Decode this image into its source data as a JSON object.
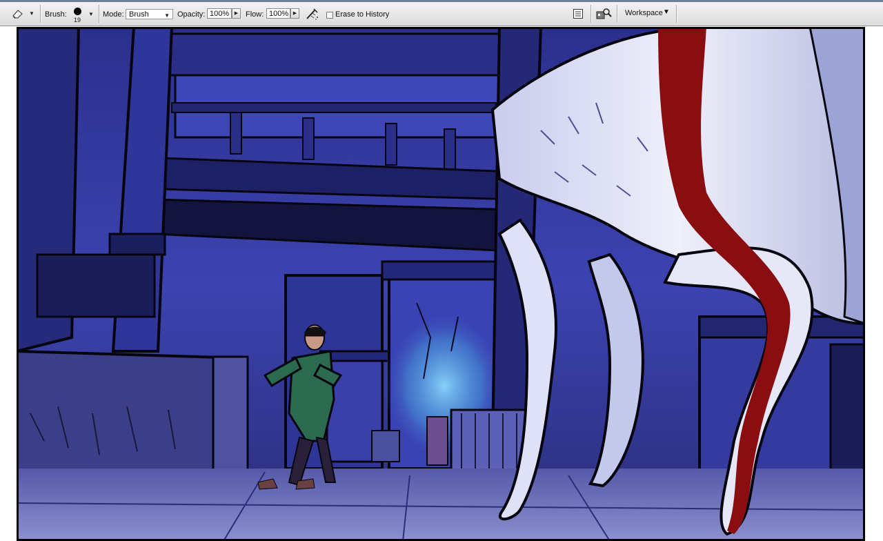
{
  "options_bar": {
    "tool_icon": "eraser-icon",
    "brush_label": "Brush:",
    "brush_size": "19",
    "mode_label": "Mode:",
    "mode_value": "Brush",
    "opacity_label": "Opacity:",
    "opacity_value": "100%",
    "flow_label": "Flow:",
    "flow_value": "100%",
    "airbrush_icon": "airbrush-icon",
    "erase_history_label": "Erase to History",
    "erase_history_checked": false,
    "palette_well_icon": "palette-well-icon",
    "file_browser_icon": "file-browser-icon",
    "workspace_label": "Workspace"
  },
  "canvas": {
    "description_icon": "comic-artwork-canvas",
    "colors": {
      "night_blue": "#3a3fa8",
      "deep_shadow": "#0c0c22",
      "wolf_white": "#d9dcf2",
      "blood_red": "#8a0d12",
      "cyan_glow": "#5fb6e6"
    }
  }
}
